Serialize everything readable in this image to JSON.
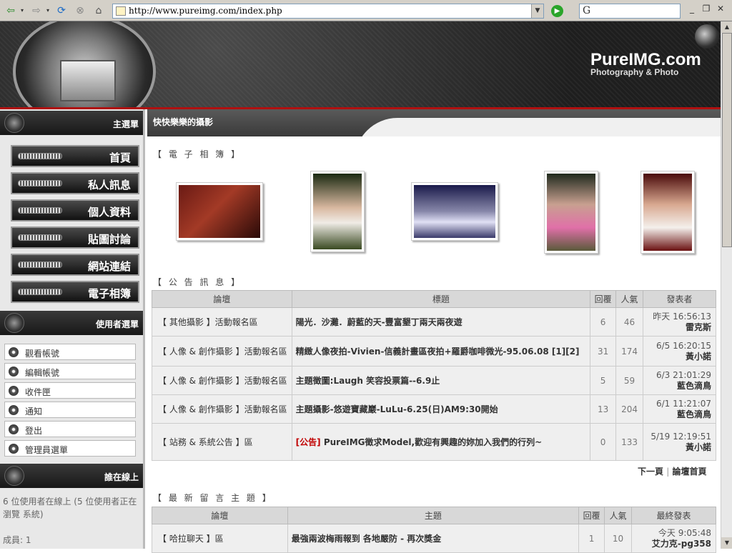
{
  "browser": {
    "url": "http://www.pureimg.com/index.php",
    "search_label": "G",
    "back_icon": "back-arrow-icon",
    "forward_icon": "forward-arrow-icon",
    "refresh_icon": "refresh-icon",
    "stop_icon": "stop-icon",
    "home_icon": "home-icon"
  },
  "header": {
    "logo": "PureIMG.com",
    "logo_sub": "Photography & Photo"
  },
  "sidebar": {
    "main_menu_title": "主選單",
    "menu": [
      "首頁",
      "私人訊息",
      "個人資料",
      "貼圖討論",
      "網站連結",
      "電子相簿"
    ],
    "user_menu_title": "使用者選單",
    "user_items": [
      "觀看帳號",
      "編輯帳號",
      "收件匣",
      "通知",
      "登出",
      "管理員選單"
    ],
    "online_title": "誰在線上",
    "online_text": "6 位使用者在線上 (5 位使用者正在瀏覽 系統)",
    "members": "成員: 1"
  },
  "main": {
    "header_title": "快快樂樂的攝影",
    "album_title": "【 電 子 相 簿 】",
    "announce_title": "【 公 告 訊 息 】",
    "announce_headers": [
      "論壇",
      "標題",
      "回覆",
      "人氣",
      "發表者"
    ],
    "announce_rows": [
      {
        "forum": "【 其他攝影 】活動報名區",
        "topic": "陽光．沙灘．蔚藍的天-豐富墾丁兩天兩夜遊",
        "replies": "6",
        "views": "46",
        "time": "昨天 16:56:13",
        "author": "雷克斯"
      },
      {
        "forum": "【 人像 & 創作攝影 】活動報名區",
        "topic": "精緻人像夜拍-Vivien-信義計畫區夜拍+羅爵咖啡微光-95.06.08 [1][2]",
        "replies": "31",
        "views": "174",
        "time": "6/5 16:20:15",
        "author": "黃小諾"
      },
      {
        "forum": "【 人像 & 創作攝影 】活動報名區",
        "topic": "主題徵圖:Laugh 笑容投票篇--6.9止",
        "replies": "5",
        "views": "59",
        "time": "6/3 21:01:29",
        "author": "藍色滴鳥"
      },
      {
        "forum": "【 人像 & 創作攝影 】活動報名區",
        "topic": "主題攝影-悠遊寶藏巖-LuLu-6.25(日)AM9:30開始",
        "replies": "13",
        "views": "204",
        "time": "6/1 11:21:07",
        "author": "藍色滴鳥"
      },
      {
        "forum": "【 站務 & 系統公告 】區",
        "tag": "[公告]",
        "topic": "PureIMG徵求Model,歡迎有興趣的妳加入我們的行列~",
        "replies": "0",
        "views": "133",
        "time": "5/19 12:19:51",
        "author": "黃小諾"
      }
    ],
    "pager_next": "下一頁",
    "pager_sep": "|",
    "pager_home": "論壇首頁",
    "latest_title": "【 最 新 留 言 主 題 】",
    "latest_headers": [
      "論壇",
      "主題",
      "回覆",
      "人氣",
      "最終發表"
    ],
    "latest_rows": [
      {
        "forum": "【 哈拉聊天 】區",
        "topic": "最強兩波梅雨報到 各地嚴防 - 再次獎金",
        "replies": "1",
        "views": "10",
        "time": "今天 9:05:48",
        "author": "艾力克-pg358"
      }
    ]
  },
  "colors": {
    "accent_red": "#b01010",
    "tag_red": "#c00000"
  }
}
